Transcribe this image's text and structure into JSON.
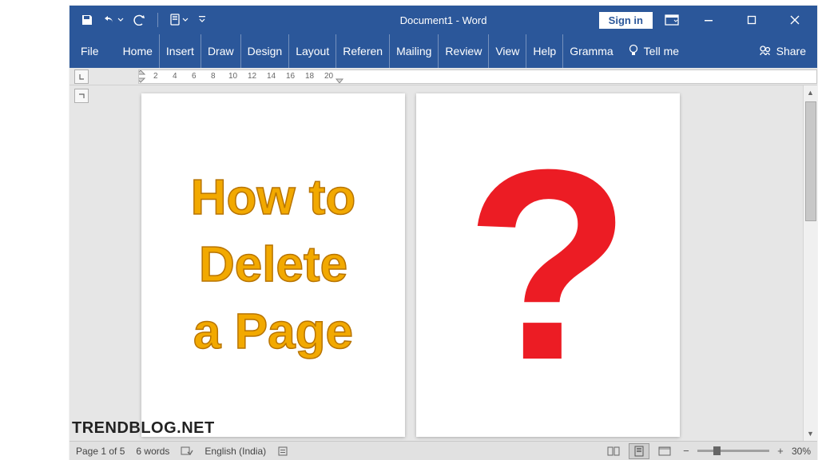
{
  "titlebar": {
    "document_title": "Document1",
    "app_name": "Word",
    "full_title": "Document1  -  Word",
    "signin_label": "Sign in"
  },
  "ribbon": {
    "file_label": "File",
    "tabs": [
      "Home",
      "Insert",
      "Draw",
      "Design",
      "Layout",
      "Referen",
      "Mailing",
      "Review",
      "View",
      "Help",
      "Gramma"
    ],
    "tell_me_label": "Tell me",
    "share_label": "Share"
  },
  "ruler": {
    "ticks": [
      "2",
      "4",
      "6",
      "8",
      "10",
      "12",
      "14",
      "16",
      "18",
      "20"
    ]
  },
  "document": {
    "page1_line1": "How to",
    "page1_line2": "Delete",
    "page1_line3": "a Page",
    "page2_symbol": "?"
  },
  "statusbar": {
    "page_info": "Page 1 of 5",
    "word_count": "6 words",
    "language": "English (India)",
    "zoom_level": "30%"
  },
  "watermark": "TRENDBLOG.NET"
}
